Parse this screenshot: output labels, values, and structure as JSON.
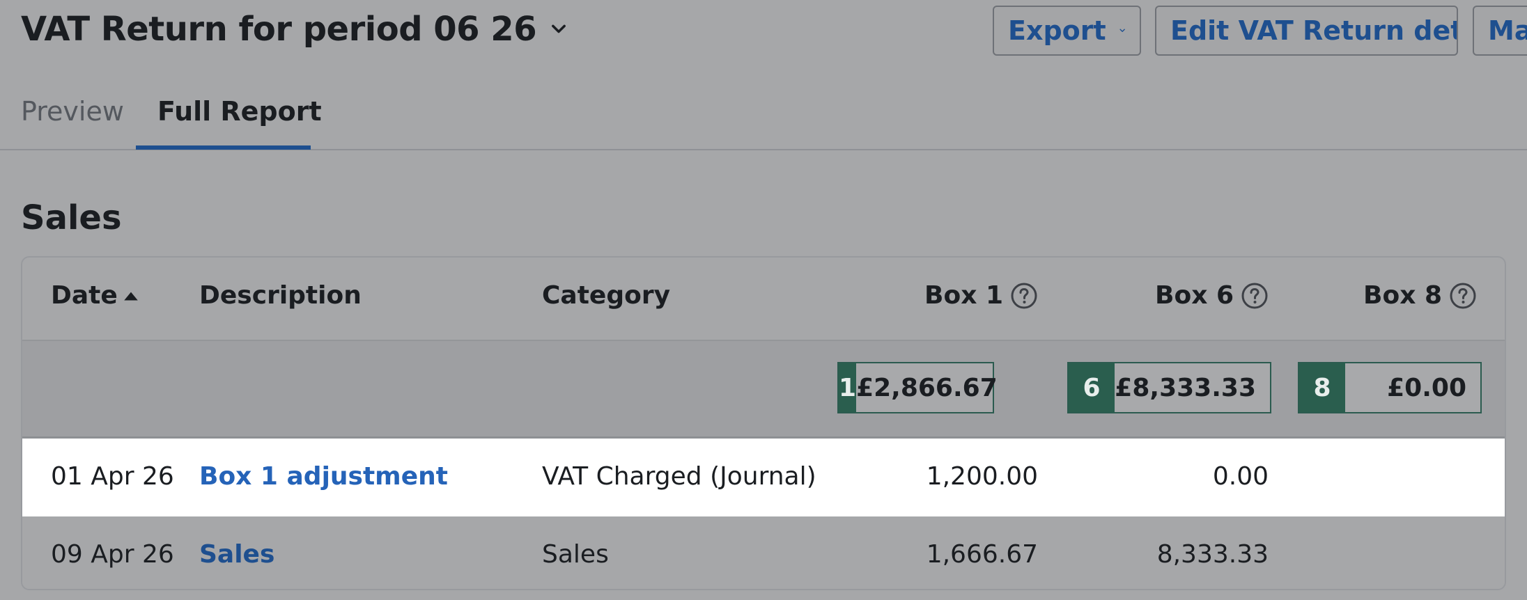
{
  "header": {
    "title": "VAT Return for period 06 26",
    "title_icon": "chevron-down-icon",
    "export_label": "Export",
    "export_icon": "chevron-down-icon",
    "edit_label": "Edit VAT Return details",
    "more_label": "Ma"
  },
  "tabs": [
    {
      "label": "Preview",
      "active": false
    },
    {
      "label": "Full Report",
      "active": true
    }
  ],
  "section": {
    "title": "Sales"
  },
  "table": {
    "columns": {
      "date": "Date",
      "date_sort_icon": "sort-ascending-icon",
      "description": "Description",
      "category": "Category",
      "box1": "Box 1",
      "box6": "Box 6",
      "box8": "Box 8",
      "help_icon": "help-circle-icon"
    },
    "totals": [
      {
        "box": "1",
        "value": "£2,866.67"
      },
      {
        "box": "6",
        "value": "£8,333.33"
      },
      {
        "box": "8",
        "value": "£0.00"
      }
    ],
    "rows": [
      {
        "date": "01 Apr 26",
        "description": "Box 1 adjustment",
        "category": "VAT Charged (Journal)",
        "box1": "1,200.00",
        "box6": "0.00",
        "box8": ""
      },
      {
        "date": "09 Apr 26",
        "description": "Sales",
        "category": "Sales",
        "box1": "1,666.67",
        "box6": "8,333.33",
        "box8": ""
      }
    ]
  },
  "colors": {
    "link": "#1e4f8f",
    "total_badge": "#2a5e4e",
    "tab_underline": "#1e4f8f",
    "highlight_row": "#ffffff"
  }
}
